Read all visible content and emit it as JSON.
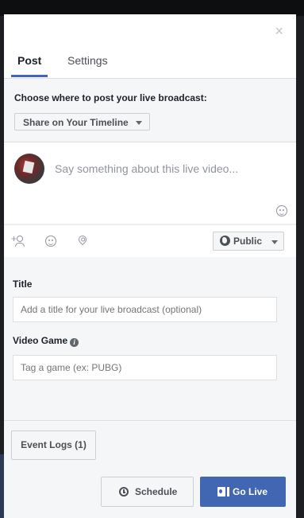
{
  "dialog": {
    "close_glyph": "×",
    "tabs": [
      {
        "label": "Post",
        "active": true
      },
      {
        "label": "Settings",
        "active": false
      }
    ]
  },
  "destination": {
    "label": "Choose where to post your live broadcast:",
    "selected": "Share on Your Timeline"
  },
  "composer": {
    "placeholder": "Say something about this live video..."
  },
  "toolbar": {
    "audience": "Public"
  },
  "form": {
    "title_label": "Title",
    "title_placeholder": "Add a title for your live broadcast (optional)",
    "game_label": "Video Game",
    "game_placeholder": "Tag a game (ex: PUBG)"
  },
  "footer": {
    "event_logs": "Event Logs (1)",
    "schedule": "Schedule",
    "go_live": "Go Live"
  },
  "colors": {
    "accent": "#4267b2",
    "panel_bg": "#f5f6f7",
    "backdrop": "#1c1e21"
  }
}
